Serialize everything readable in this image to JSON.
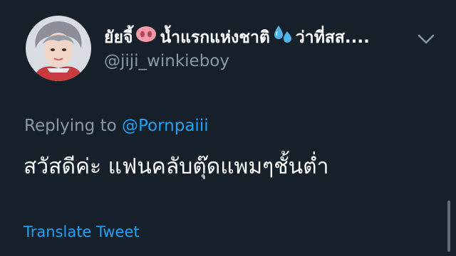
{
  "tweet": {
    "display_name_part1": "ยัยจี้",
    "display_name_part2": "น้ำแรกแห่งชาติ",
    "display_name_part3": "ว่าที่สส....",
    "name_emojis": [
      "pig-nose-emoji",
      "sweat-droplets-emoji"
    ],
    "handle": "@jiji_winkieboy",
    "reply_prefix": "Replying to",
    "reply_handle": "@Pornpaiii",
    "text": "สวัสดีค่ะ แฟนคลับตุ๊ดแพมๆชั้นต่ำ",
    "translate_label": "Translate Tweet"
  },
  "icons": {
    "menu": "chevron-down-icon"
  },
  "colors": {
    "background": "#15202b",
    "text": "#ffffff",
    "secondary_text": "#8899a6",
    "link": "#1da1f2"
  }
}
